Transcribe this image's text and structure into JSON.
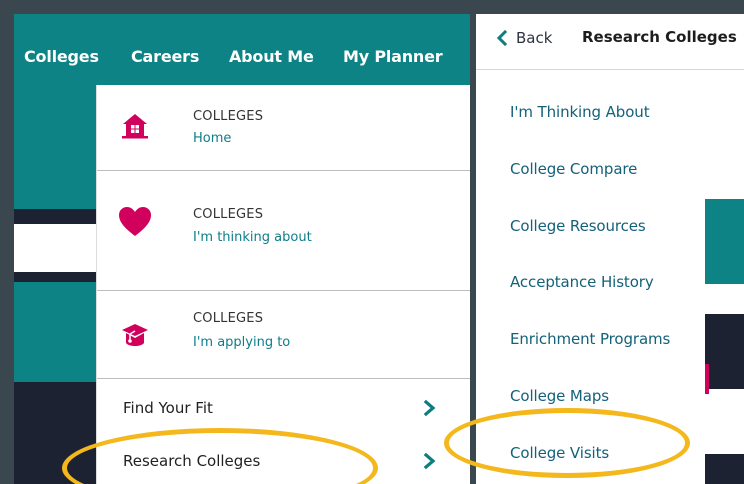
{
  "top_nav": {
    "items": [
      "Colleges",
      "Careers",
      "About Me",
      "My Planner"
    ]
  },
  "dropdown": {
    "cards": [
      {
        "category": "COLLEGES",
        "label": "Home",
        "icon": "house-icon"
      },
      {
        "category": "COLLEGES",
        "label": "I'm thinking about",
        "icon": "heart-icon"
      },
      {
        "category": "COLLEGES",
        "label": "I'm applying to",
        "icon": "graduation-cap-icon"
      }
    ],
    "links": [
      {
        "label": "Find Your Fit"
      },
      {
        "label": "Research Colleges"
      }
    ]
  },
  "submenu": {
    "back_label": "Back",
    "title": "Research Colleges",
    "items": [
      "I'm Thinking About",
      "College Compare",
      "College Resources",
      "Acceptance History",
      "Enrichment Programs",
      "College Maps",
      "College Visits"
    ]
  },
  "colors": {
    "teal": "#0e8385",
    "navy": "#1c2232",
    "accent_pink": "#d2005d",
    "link_teal": "#14617a",
    "highlight": "#f4b81d"
  }
}
